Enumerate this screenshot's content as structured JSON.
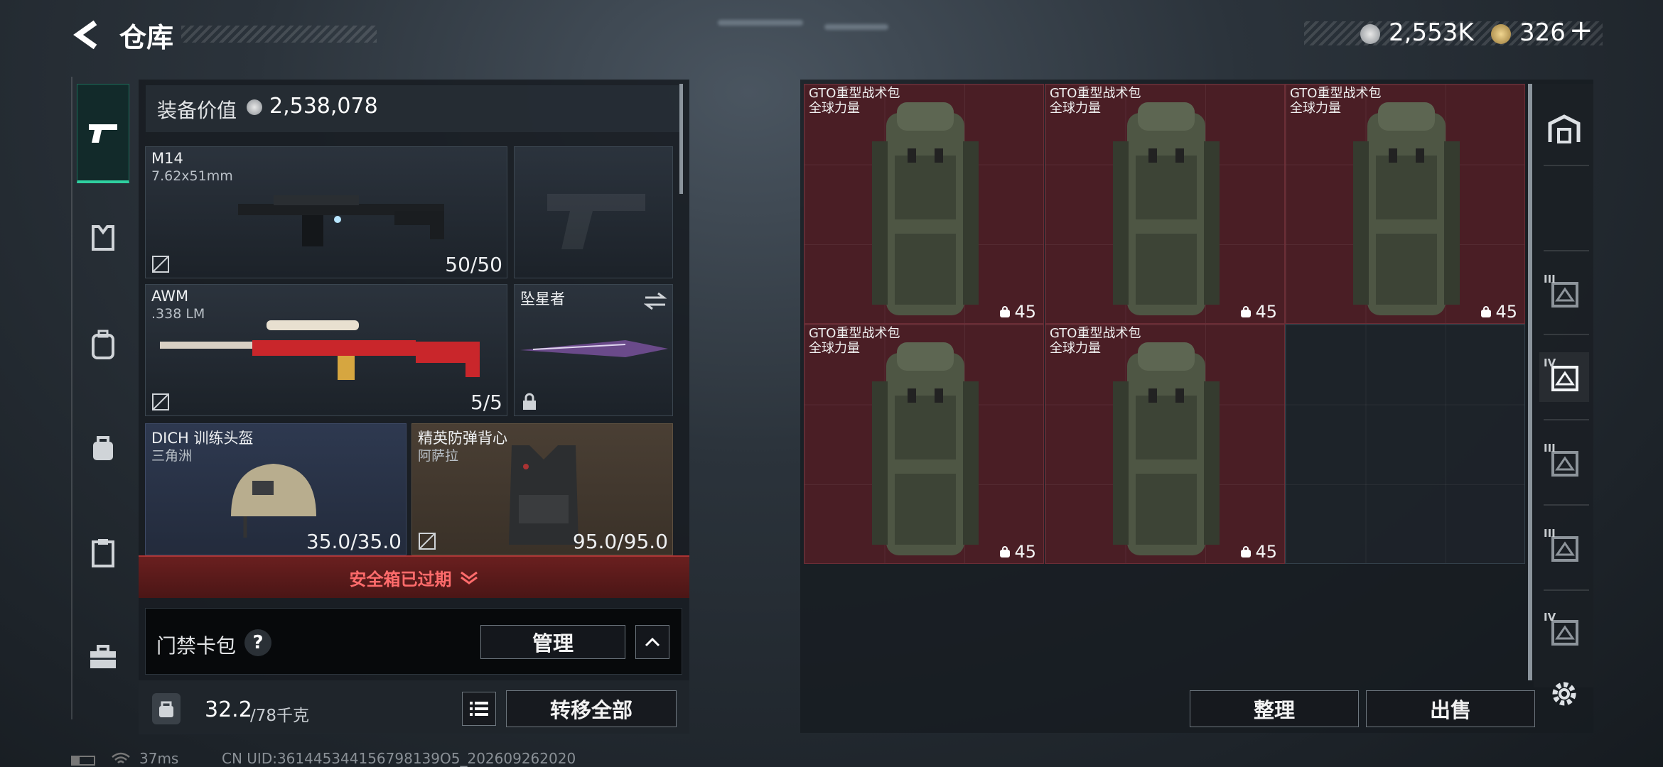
{
  "header": {
    "title": "仓库",
    "currency1": "2,553K",
    "currency2": "326",
    "add_symbol": "+"
  },
  "left": {
    "equip_value_label": "装备价值",
    "equip_value": "2,538,078",
    "slots": [
      {
        "name": "M14",
        "sub": "7.62x51mm",
        "durability": "50/50"
      },
      {
        "name": "AWM",
        "sub": ".338 LM",
        "durability": "5/5"
      },
      {
        "name": "坠星者"
      },
      {
        "name": "DICH 训练头盔",
        "sub": "三角洲",
        "durability": "35.0/35.0"
      },
      {
        "name": "精英防弹背心",
        "sub": "阿萨拉",
        "durability": "95.0/95.0"
      }
    ],
    "safebox_text": "安全箱已过期",
    "keycard_label": "门禁卡包",
    "help_symbol": "?",
    "manage_label": "管理",
    "weight_current": "32.2",
    "weight_max": "/78千克",
    "transfer_all_label": "转移全部"
  },
  "storage": {
    "items": [
      {
        "name": "GTO重型战术包",
        "sub": "全球力量",
        "count": "45"
      },
      {
        "name": "GTO重型战术包",
        "sub": "全球力量",
        "count": "45"
      },
      {
        "name": "GTO重型战术包",
        "sub": "全球力量",
        "count": "45"
      },
      {
        "name": "GTO重型战术包",
        "sub": "全球力量",
        "count": "45"
      },
      {
        "name": "GTO重型战术包",
        "sub": "全球力量",
        "count": "45"
      }
    ],
    "sort_label": "整理",
    "sell_label": "出售"
  },
  "right_tabs": [
    "III",
    "IV",
    "III",
    "III",
    "IV"
  ],
  "status": {
    "ping": "37ms",
    "uid": "CN UID:361445344156798139O5_202609262020"
  },
  "colors": {
    "accent_green": "#2fd0a0",
    "red_item_bg": "#4a1e25",
    "expired_red": "#ff6b6b"
  }
}
